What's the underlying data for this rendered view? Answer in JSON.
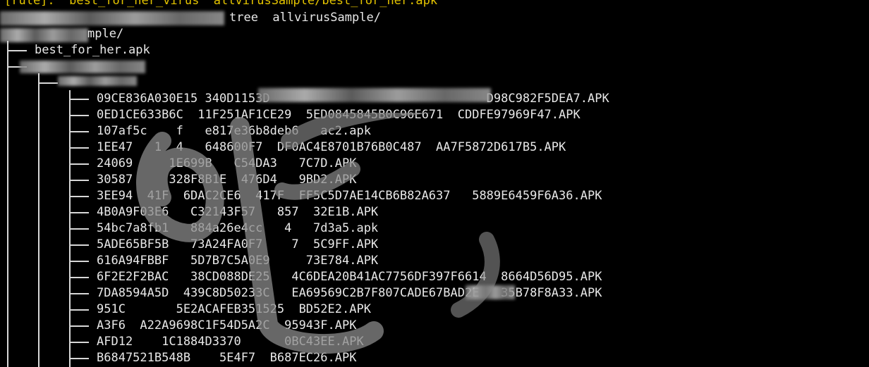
{
  "terminal": {
    "rule_line": "[rule]:  best_for_her_virus  allvirusSample/best_for_her.apk",
    "command": "tree  allvirusSample/",
    "root_dir": "mple/",
    "tree": {
      "apk_file": "best_for_her.apk",
      "files": [
        "09CE836A030E15 340D1153D                              D98C982F5DEA7.APK",
        "0ED1CE633B6C  11F251AF1CE29  5ED0845845B0C96E671  CDDFE97969F47.APK",
        "107af5c    f   e817e36b8deb6   ac2.apk",
        "1EE47   1  4   648600F7  DF0AC4E8701B76B0C487  AA7F5872D617B5.APK",
        "24069     1E699B   C54DA3   7C7D.APK",
        "30587     328F8B1E  476D4   9BD2.APK",
        "3EE94  41F  6DAC2CE6  417F  FF5C5D7AE14CB6B82A637   5889E6459F6A36.APK",
        "4B0A9F03E6   C32143F57   857  32E1B.APK",
        "54bc7a8fb1   884a26e4cc   4   7d3a5.apk",
        "5ADE65BF5B   73A24FA0F7    7  5C9FF.APK",
        "616A94FBBF   5D7B7C5A0E9     73E784.APK",
        "6F2E2F2BAC   38CD088DE25   4C6DEA20B41AC7756DF397F6614  8664D56D95.APK",
        "7DA8594A5D  439C8D50233C   EA69569C2B7F807CADE67BAD2E   35B78F8A33.APK",
        "951C       5E2ACAFEB351525  BD52E2.APK",
        "A3F6  A22A9698C1F54D5A2C  95943F.APK",
        "AFD12    1C1884D3370      0BC43EE.APK",
        "B6847521B548B    5E4F7  B687EC26.APK"
      ]
    }
  },
  "colors": {
    "background": "#000000",
    "text": "#e8e8e8",
    "prompt_yellow": "#e3c300"
  }
}
